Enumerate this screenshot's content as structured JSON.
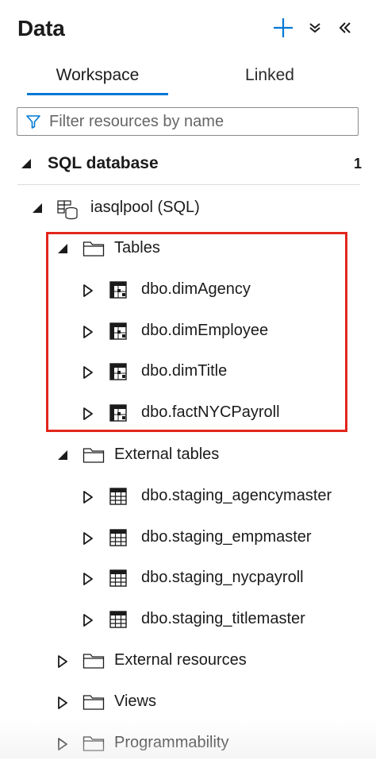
{
  "header": {
    "title": "Data",
    "add_icon": "plus-icon",
    "expand_icon": "double-chevron-down-icon",
    "collapse_icon": "double-chevron-left-icon",
    "accent_color": "#0078d4"
  },
  "tabs": [
    {
      "label": "Workspace",
      "active": true
    },
    {
      "label": "Linked",
      "active": false
    }
  ],
  "filter": {
    "placeholder": "Filter resources by name",
    "value": "",
    "icon": "filter-icon"
  },
  "section": {
    "label": "SQL database",
    "count": "1",
    "expanded": true
  },
  "tree": {
    "pool": {
      "label": "iasqlpool (SQL)",
      "icon": "sql-pool-icon",
      "expanded": true
    },
    "tables": {
      "label": "Tables",
      "expanded": true,
      "highlight_color": "#e2261b",
      "items": [
        "dbo.dimAgency",
        "dbo.dimEmployee",
        "dbo.dimTitle",
        "dbo.factNYCPayroll"
      ]
    },
    "external_tables": {
      "label": "External tables",
      "expanded": true,
      "items": [
        "dbo.staging_agencymaster",
        "dbo.staging_empmaster",
        "dbo.staging_nycpayroll",
        "dbo.staging_titlemaster"
      ]
    },
    "external_resources": {
      "label": "External resources",
      "expanded": false
    },
    "views": {
      "label": "Views",
      "expanded": false
    },
    "programmability": {
      "label": "Programmability",
      "expanded": false
    }
  }
}
